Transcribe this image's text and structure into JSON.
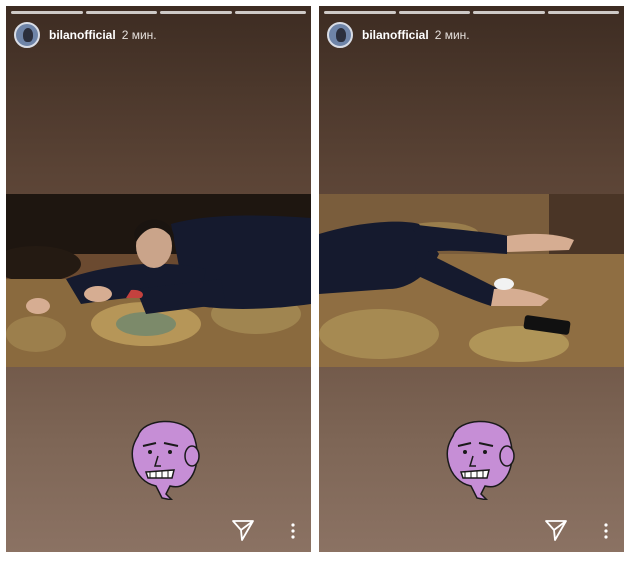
{
  "stories": [
    {
      "username": "bilanofficial",
      "time": "2 мин."
    },
    {
      "username": "bilanofficial",
      "time": "2 мин."
    }
  ],
  "icons": {
    "send": "send-icon",
    "more": "more-vertical-icon",
    "sticker": "purple-face-sticker"
  },
  "colors": {
    "background_top": "#3d2c22",
    "background_bottom": "#8b7263",
    "sticker": "#c68ed6"
  }
}
